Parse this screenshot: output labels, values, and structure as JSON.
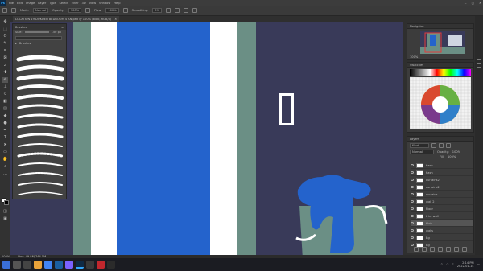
{
  "menubar": {
    "app_logo": "Ps",
    "items": [
      "File",
      "Edit",
      "Image",
      "Layer",
      "Type",
      "Select",
      "Filter",
      "3D",
      "View",
      "Window",
      "Help"
    ]
  },
  "options": {
    "mode_label": "Mode:",
    "mode_value": "Normal",
    "opacity_label": "Opacity:",
    "opacity_value": "100%",
    "flow_label": "Flow:",
    "flow_value": "100%",
    "smoothing_label": "Smoothing:",
    "smoothing_value": "0%"
  },
  "document": {
    "tab_title": "LOCATION 19 DOKDEN BEDROOM 4 AN.psd @ 100% (blob, RGB/8)",
    "zoom": "100%",
    "doc_size": "Doc: 49.8M/744.5M"
  },
  "brushes_panel": {
    "title": "Brushes",
    "size_label": "Size:",
    "size_value": "150 px",
    "group_name": "Brushes"
  },
  "navigator_panel": {
    "title": "Navigator",
    "zoom": "100%"
  },
  "swatches_panel": {
    "title": "Swatches"
  },
  "layers_panel": {
    "title": "Layers",
    "search_kind": "Kind",
    "blend_mode": "Normal",
    "opacity_label": "Opacity:",
    "opacity_value": "100%",
    "fill_label": "Fill:",
    "fill_value": "100%",
    "layers": [
      "flash",
      "flash",
      "curtains2",
      "curtains2",
      "curtains",
      "wall 2",
      "Floor",
      "trim wall",
      "blob",
      "walls",
      "Bg",
      "Bg"
    ]
  },
  "taskbar": {
    "time": "2:14 PM",
    "date": "2022-01-14"
  },
  "colors": {
    "canvas_bg": "#393a59",
    "sage": "#6b8f85",
    "blue": "#2463cc",
    "white": "#ffffff",
    "ps_blue": "#31a8ff"
  }
}
